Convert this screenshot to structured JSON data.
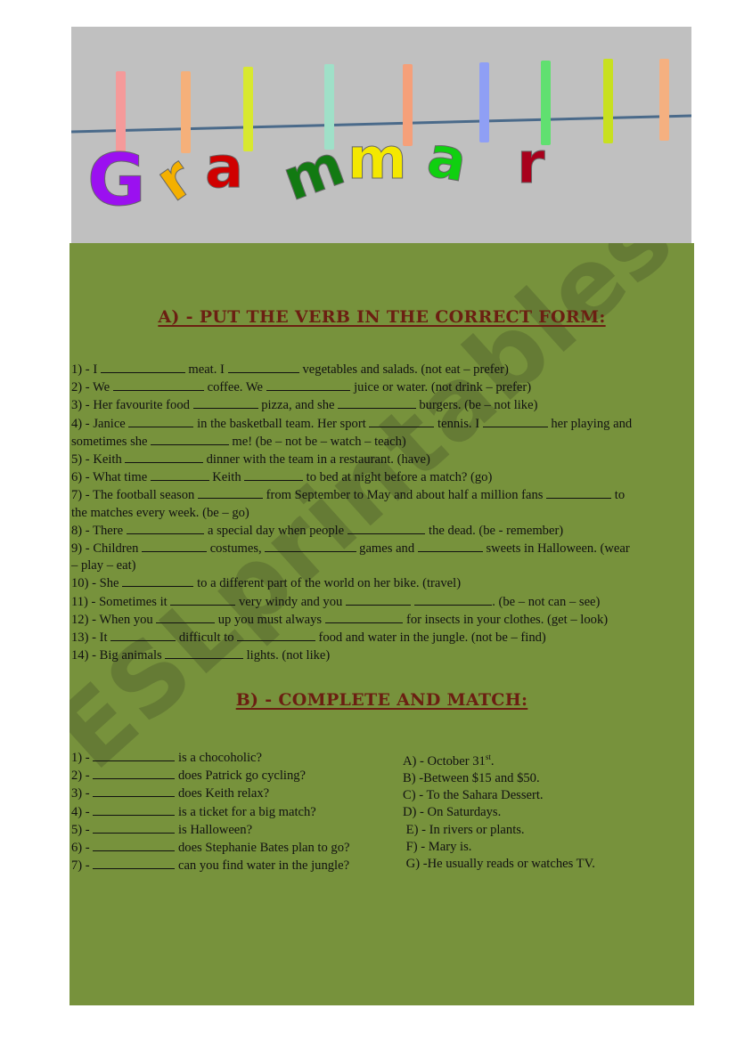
{
  "banner": {
    "title_letters": [
      "G",
      "r",
      "a",
      "m",
      "m",
      "a",
      "r"
    ],
    "letter_colors": [
      "#9b10f0",
      "#f4b000",
      "#d00000",
      "#127a12",
      "#f4e800",
      "#10d010",
      "#a8001c"
    ],
    "peg_colors": [
      "#f59a9a",
      "#f5b07a",
      "#d8e830",
      "#9fe0c8",
      "#f5a07a",
      "#8f9ff5",
      "#60e070",
      "#c8e020",
      "#f5b080"
    ]
  },
  "watermark": "ESLprintables.com",
  "section_a": {
    "title": "A) - Put the verb in the correct form:",
    "items": [
      [
        "1) - I ",
        "B13",
        " meat. I ",
        "B11",
        " vegetables and salads. (not eat – prefer)"
      ],
      [
        "2) - We ",
        "B14",
        " coffee. We ",
        "B13",
        " juice or water. (not drink – prefer)"
      ],
      [
        "3) - Her favourite food ",
        "B10",
        " pizza, and she ",
        "B12",
        " burgers. (be – not like)"
      ],
      [
        "4) - Janice ",
        "B10",
        " in the basketball team. Her sport ",
        "B10",
        " tennis. I ",
        "B10",
        " her playing and"
      ],
      [
        "sometimes she ",
        "B12",
        " me! (be – not be – watch – teach)"
      ],
      [
        "5) - Keith ",
        "B12",
        " dinner with the team in a restaurant. (have)"
      ],
      [
        "6) - What time ",
        "B9",
        " Keith ",
        "B9",
        " to bed at night before a match? (go)"
      ],
      [
        "7) - The football season ",
        "B10",
        " from September to May and about half a million fans ",
        "B10",
        " to"
      ],
      [
        "the matches every week. (be – go)"
      ],
      [
        "8) - There ",
        "B12",
        " a special day when people ",
        "B12",
        " the dead. (be - remember)"
      ],
      [
        "9) - Children ",
        "B10",
        " costumes, ",
        "B14",
        " games and ",
        "B10",
        " sweets in Halloween. (wear"
      ],
      [
        "– play – eat)"
      ],
      [
        "10) - She ",
        "B11",
        " to a different part of the world on her bike. (travel)"
      ],
      [
        "11) - Sometimes it ",
        "B10",
        " very windy and you ",
        "B10",
        " ",
        "B12",
        ". (be – not can – see)"
      ],
      [
        "12) - When you ",
        "B9",
        " up you must always ",
        "B12",
        " for insects in your clothes. (get – look)"
      ],
      [
        "13) - It ",
        "B10",
        " difficult to ",
        "B12",
        " food and water in the jungle. (not be – find)"
      ],
      [
        "14) - Big animals ",
        "B12",
        " lights. (not like)"
      ]
    ]
  },
  "section_b": {
    "title": "B) - Complete and match:",
    "questions": [
      {
        "num": "1) - ",
        "text": " is a chocoholic?"
      },
      {
        "num": "2) - ",
        "text": " does Patrick go cycling?"
      },
      {
        "num": "3) - ",
        "text": " does Keith relax?"
      },
      {
        "num": "4) - ",
        "text": " is a ticket for a big match?"
      },
      {
        "num": "5) - ",
        "text": " is Halloween?"
      },
      {
        "num": "6) - ",
        "text": " does Stephanie Bates plan to go?"
      },
      {
        "num": "7) - ",
        "text": " can you find water in the jungle?"
      }
    ],
    "answers": [
      {
        "text": "A) - October 31",
        "sup": "st",
        "after": "."
      },
      {
        "text": "B) -Between $15 and $50.",
        "sup": "",
        "after": ""
      },
      {
        "text": "C) - To the Sahara Dessert.",
        "sup": "",
        "after": ""
      },
      {
        "text": "D) - On Saturdays.",
        "sup": "",
        "after": ""
      },
      {
        "text": " E) - In rivers or plants.",
        "sup": "",
        "after": ""
      },
      {
        "text": " F) - Mary is.",
        "sup": "",
        "after": ""
      },
      {
        "text": " G) -He usually reads or watches TV.",
        "sup": "",
        "after": ""
      }
    ]
  }
}
